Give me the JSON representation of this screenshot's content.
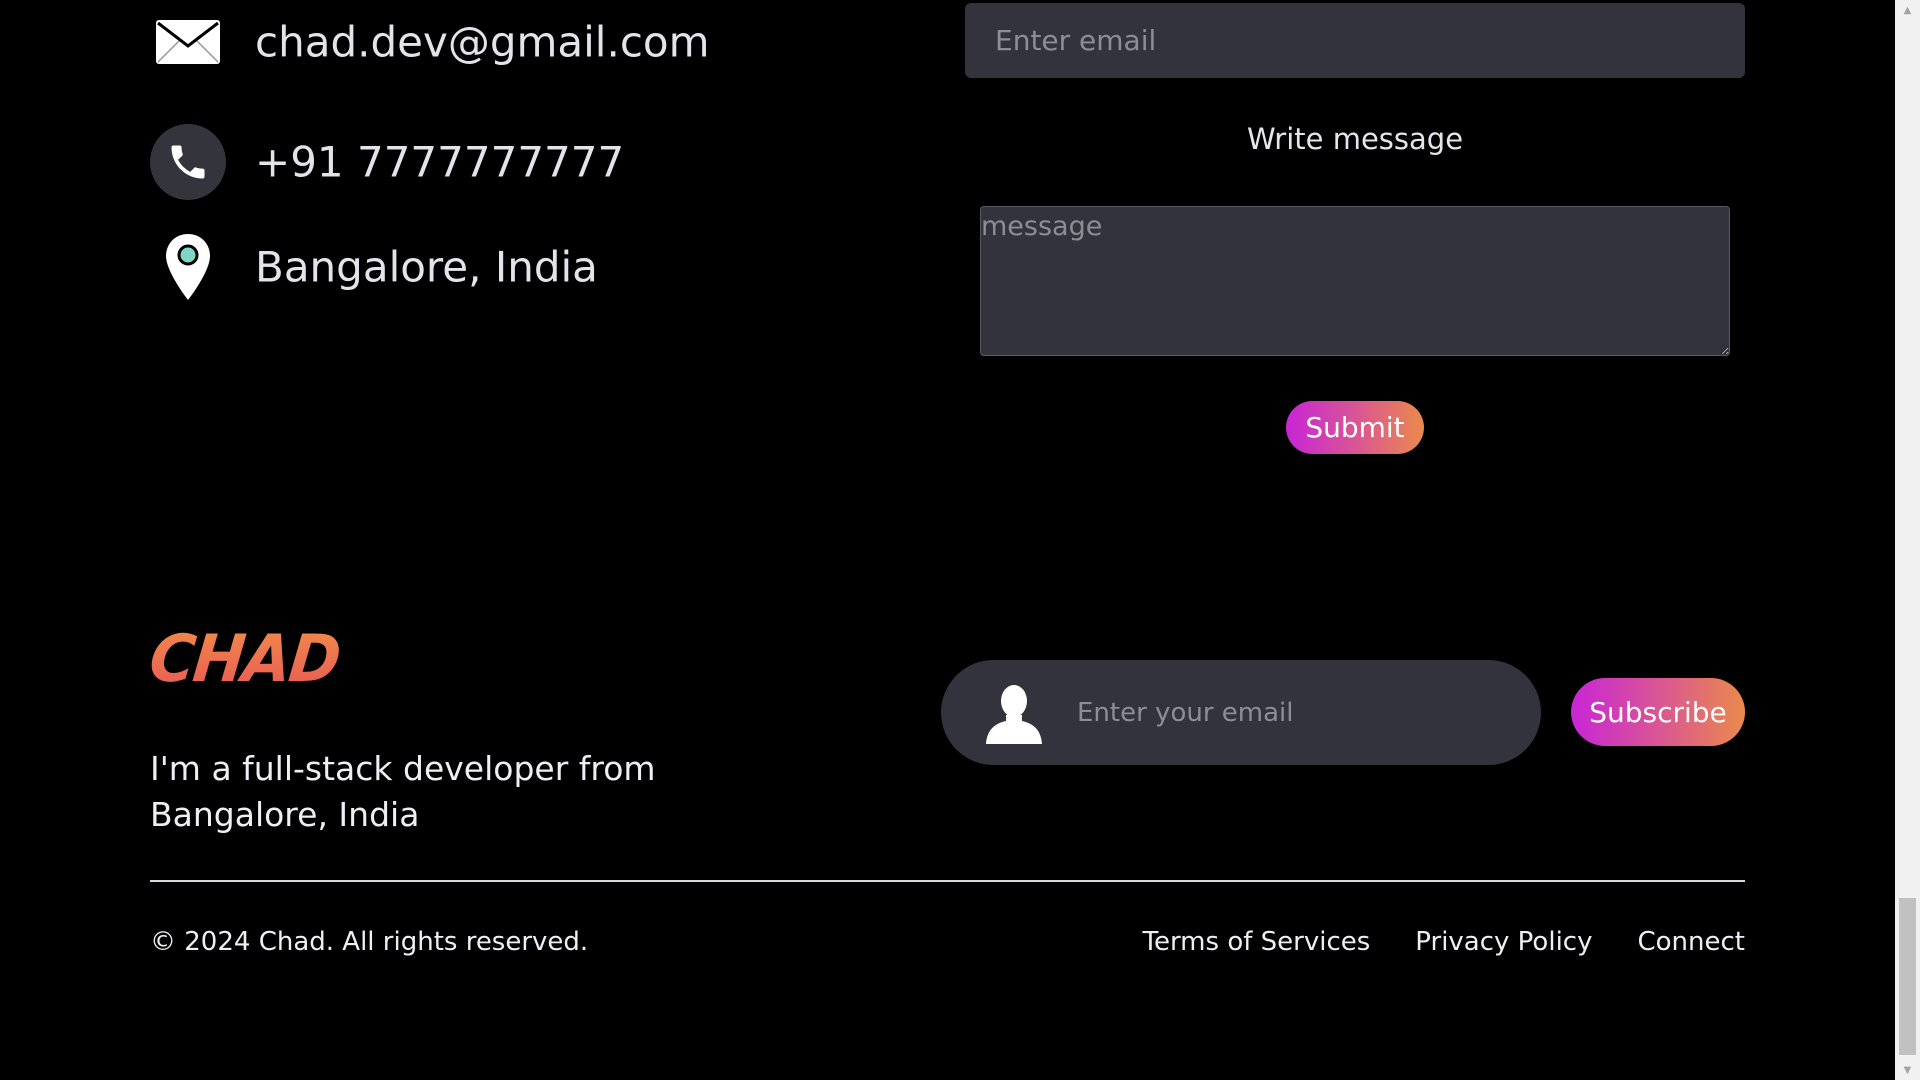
{
  "contact": {
    "email": "chad.dev@gmail.com",
    "phone": "+91 7777777777",
    "location": "Bangalore, India",
    "icons": [
      "envelope-icon",
      "phone-icon",
      "location-pin-icon"
    ]
  },
  "form": {
    "email_placeholder": "Enter email",
    "write_label": "Write message",
    "message_placeholder": "message",
    "submit_label": "Submit"
  },
  "footer": {
    "logo": "CHAD",
    "tagline": "I'm a full-stack developer from Bangalore, India",
    "subscribe_placeholder": "Enter your email",
    "subscribe_label": "Subscribe",
    "copyright": "© 2024 Chad. All rights reserved.",
    "links": [
      {
        "label": "Terms of Services"
      },
      {
        "label": "Privacy Policy"
      },
      {
        "label": "Connect"
      }
    ]
  },
  "colors": {
    "background": "#000000",
    "input_bg": "#33333d",
    "gradient_start": "#c726d6",
    "gradient_end": "#ea8a4a",
    "logo_orange": "#f2894a",
    "pin_teal": "#7fd6c4"
  }
}
